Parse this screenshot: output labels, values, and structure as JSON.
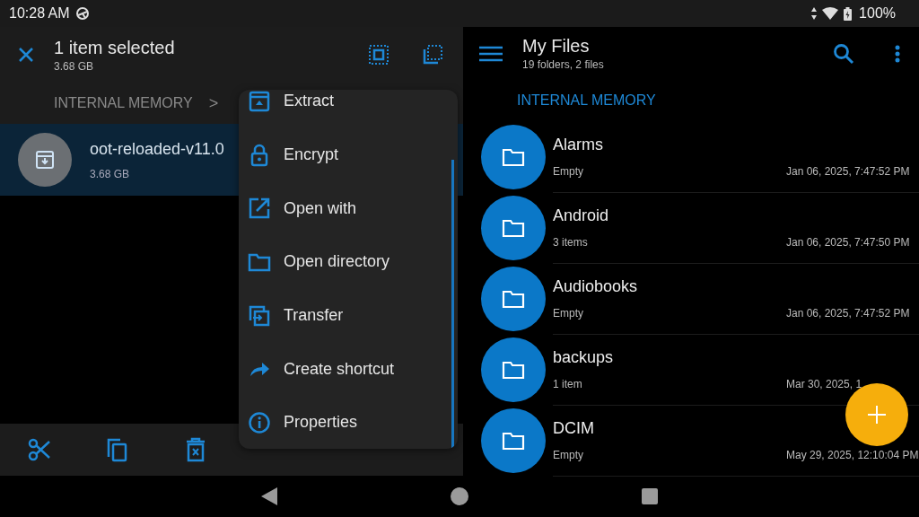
{
  "status_bar": {
    "time": "10:28 AM",
    "battery": "100%"
  },
  "selection_bar": {
    "title": "1 item selected",
    "size": "3.68 GB"
  },
  "breadcrumb": {
    "root": "INTERNAL MEMORY",
    "separator": ">"
  },
  "selected_file": {
    "name": "oot-reloaded-v11.0",
    "size": "3.68 GB",
    "selected": true
  },
  "context_menu": [
    "Extract",
    "Encrypt",
    "Open with",
    "Open directory",
    "Transfer",
    "Create shortcut",
    "Properties"
  ],
  "files_header": {
    "title": "My Files",
    "subtitle": "19 folders, 2 files"
  },
  "location": "INTERNAL MEMORY",
  "folders": [
    {
      "name": "Alarms",
      "info": "Empty",
      "date": "Jan 06, 2025, 7:47:52 PM"
    },
    {
      "name": "Android",
      "info": "3 items",
      "date": "Jan 06, 2025, 7:47:50 PM"
    },
    {
      "name": "Audiobooks",
      "info": "Empty",
      "date": "Jan 06, 2025, 7:47:52 PM"
    },
    {
      "name": "backups",
      "info": "1 item",
      "date": "Mar 30, 2025, 1"
    },
    {
      "name": "DCIM",
      "info": "Empty",
      "date": "May 29, 2025, 12:10:04 PM"
    }
  ]
}
